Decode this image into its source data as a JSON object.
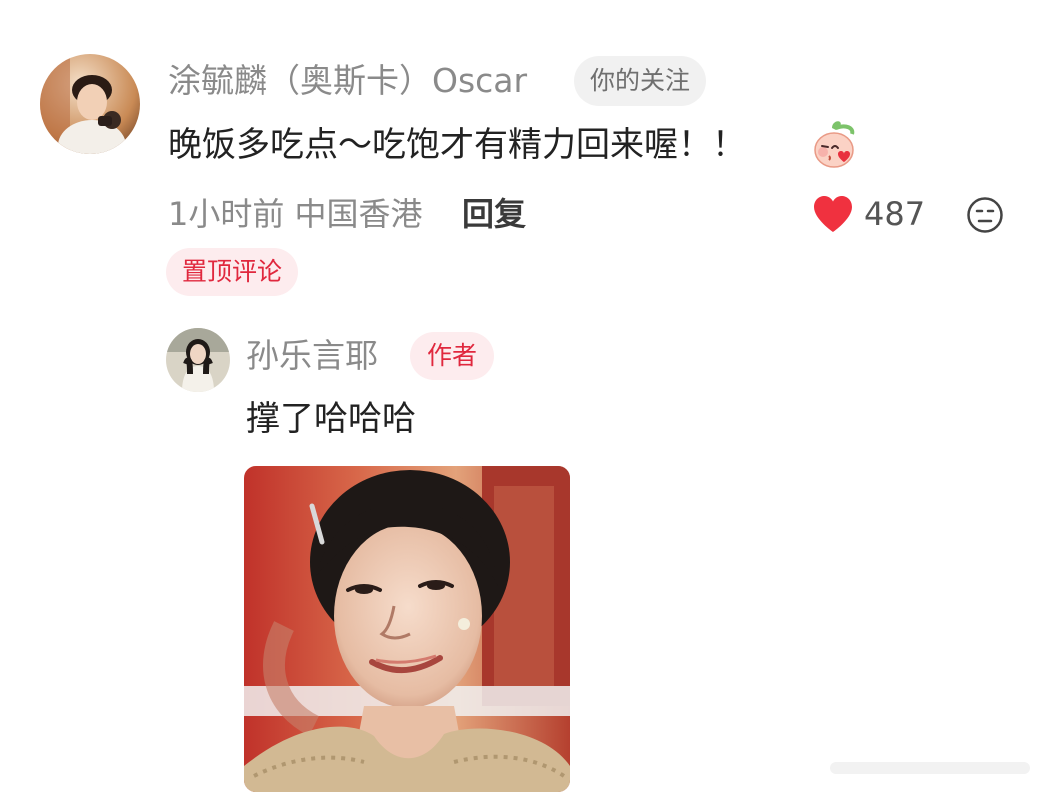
{
  "comment": {
    "username": "涂毓麟（奥斯卡）Oscar",
    "follow_tag": "你的关注",
    "text": "晚饭多吃点～吃饱才有精力回来喔！！",
    "emoji": "peach-face-emoji",
    "time_location": "1小时前 中国香港",
    "reply_label": "回复",
    "like_count": "487",
    "pinned_tag": "置顶评论",
    "icons": {
      "like": "heart-icon",
      "dislike": "dislike-face-icon"
    },
    "colors": {
      "like": "#f0313f",
      "tag_red": "#e0283e",
      "tag_red_bg": "#fdecee"
    }
  },
  "reply": {
    "username": "孙乐言耶",
    "author_tag": "作者",
    "text": "撑了哈哈哈",
    "image": "reply-photo"
  }
}
